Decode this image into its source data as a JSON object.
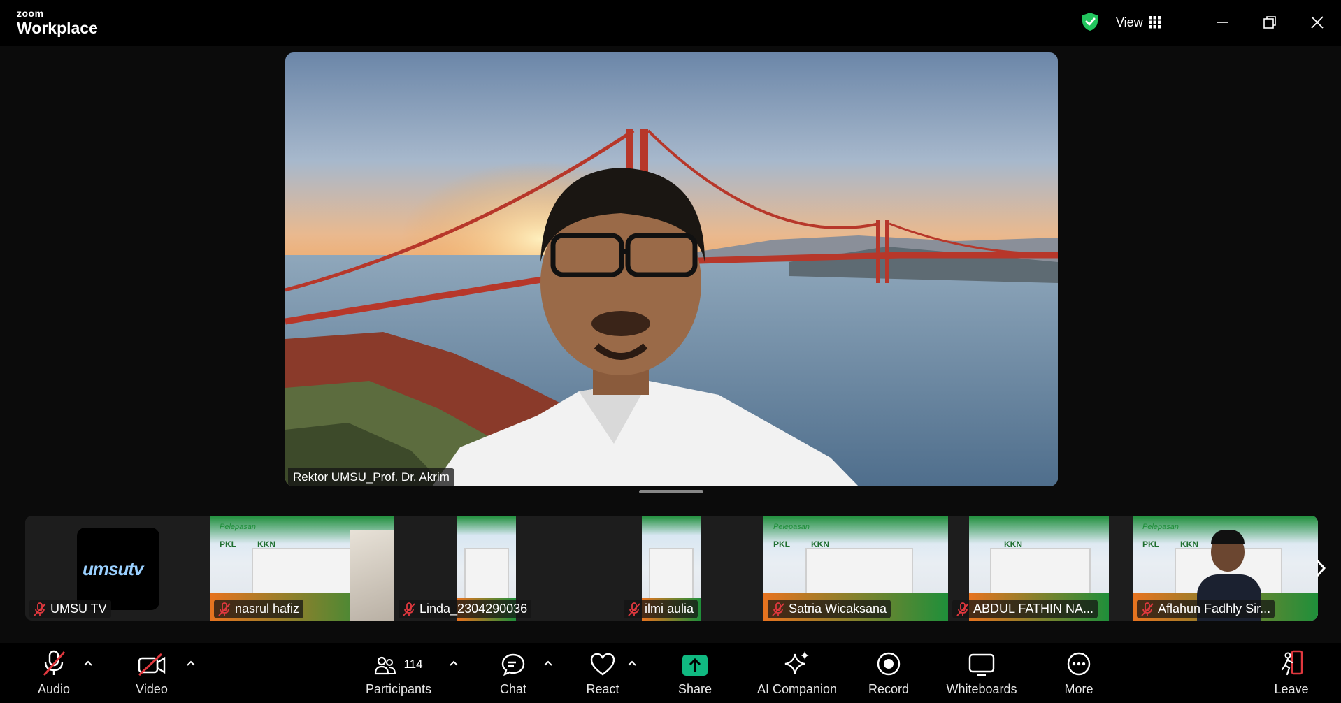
{
  "app": {
    "brand_top": "zoom",
    "brand_bottom": "Workplace"
  },
  "header": {
    "view_label": "View"
  },
  "main_video": {
    "speaker_name": "Rektor UMSU_Prof. Dr. Akrim"
  },
  "strip": {
    "tiles": [
      {
        "name": "UMSU TV",
        "logo_text": "umsutv"
      },
      {
        "name": "nasrul hafiz"
      },
      {
        "name": "Linda_2304290036"
      },
      {
        "name": "ilmi aulia"
      },
      {
        "name": "Satria Wicaksana"
      },
      {
        "name": "ABDUL FATHIN NA..."
      },
      {
        "name": "Aflahun Fadhly Sir..."
      }
    ],
    "banner_words": {
      "pkl": "PKL",
      "kkn": "KKN",
      "script": "Pelepasan"
    }
  },
  "toolbar": {
    "audio": "Audio",
    "video": "Video",
    "participants": "Participants",
    "participants_count": "114",
    "chat": "Chat",
    "react": "React",
    "share": "Share",
    "ai_companion": "AI Companion",
    "record": "Record",
    "whiteboards": "Whiteboards",
    "more": "More",
    "leave": "Leave"
  },
  "colors": {
    "shield_green": "#22c55e",
    "share_green": "#10b981",
    "leave_red": "#e0383e",
    "muted_red": "#e0383e"
  }
}
